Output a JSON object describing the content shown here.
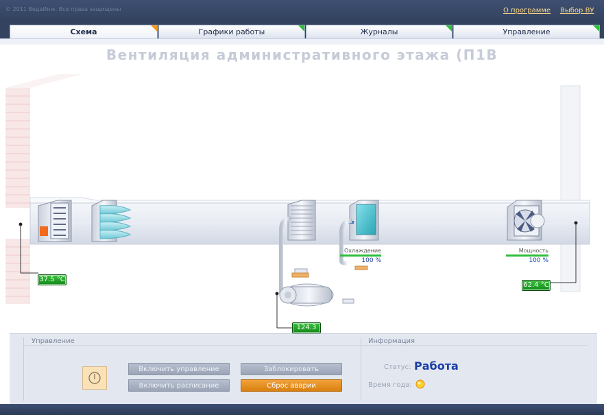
{
  "header": {
    "app_title": "© 2011 ВедаИнж. Все права защищены",
    "links": {
      "about": "О программе",
      "select_vu": "Выбор ВУ"
    }
  },
  "tabs": [
    {
      "label": "Схема",
      "active": true,
      "flag": "orange"
    },
    {
      "label": "Графики работы",
      "active": false,
      "flag": "green"
    },
    {
      "label": "Журналы",
      "active": false,
      "flag": "green"
    },
    {
      "label": "Управление",
      "active": false,
      "flag": "green"
    }
  ],
  "scheme": {
    "title": "Вентиляция административного этажа (П1В",
    "outdoor_temp": "37.5 °C",
    "water_temp": "124.3 °C",
    "supply_temp": "62.4 °C",
    "cooling": {
      "label": "Охлаждение",
      "value": "100 %",
      "level": 1.0
    },
    "power": {
      "label": "Мощность",
      "value": "100 %",
      "level": 1.0
    }
  },
  "control": {
    "title": "Управление",
    "buttons": {
      "enable_control": "Включить управление",
      "enable_schedule": "Включить расписание",
      "lock": "Заблокировать",
      "reset_alarm": "Сброс аварии"
    }
  },
  "info": {
    "title": "Информация",
    "status_label": "Статус:",
    "status_value": "Работа",
    "season_label": "Время года:",
    "season_icon": "sun-icon"
  },
  "colors": {
    "header_bg": "#33435f",
    "accent_orange": "#f39a1c",
    "indicator_green": "#2dbd3a",
    "status_text": "#1b3fa8"
  }
}
